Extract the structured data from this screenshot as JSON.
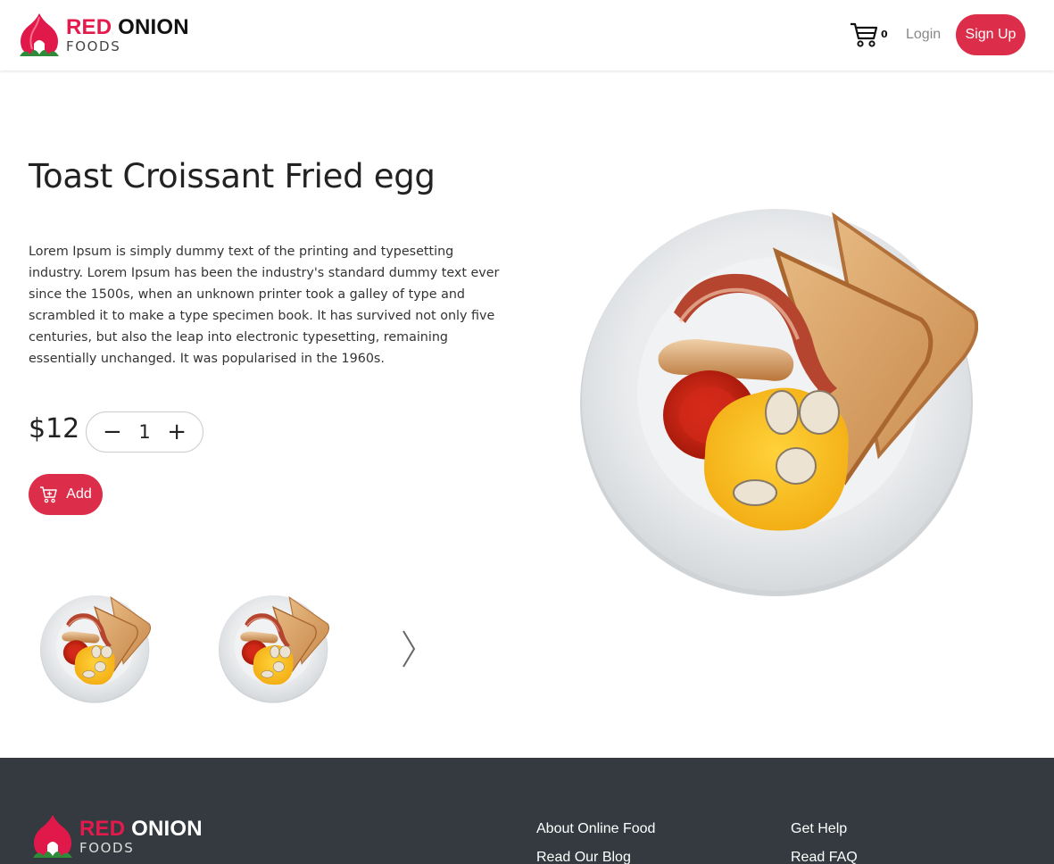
{
  "brand": {
    "name_red": "RED",
    "name_dark": "ONION",
    "sub": "FOODS",
    "accent_color": "#dc2e4a"
  },
  "header": {
    "cart_icon": "cart-icon",
    "cart_count": "0",
    "login_label": "Login",
    "signup_label": "Sign Up"
  },
  "product": {
    "title": "Toast Croissant Fried egg",
    "description": "Lorem Ipsum is simply dummy text of the printing and typesetting industry. Lorem Ipsum has been the industry's standard dummy text ever since the 1500s, when an unknown printer took a galley of type and scrambled it to make a type specimen book. It has survived not only five centuries, but also the leap into electronic typesetting, remaining essentially unchanged. It was popularised in the 1960s.",
    "price": "$12",
    "quantity": "1",
    "minus_label": "−",
    "plus_label": "+",
    "add_label": "Add"
  },
  "gallery": {
    "thumbnails": [
      "breakfast-plate",
      "breakfast-plate"
    ],
    "next_icon": "chevron-right-icon"
  },
  "footer": {
    "col1": [
      "About Online Food",
      "Read Our Blog"
    ],
    "col2": [
      "Get Help",
      "Read FAQ"
    ]
  }
}
